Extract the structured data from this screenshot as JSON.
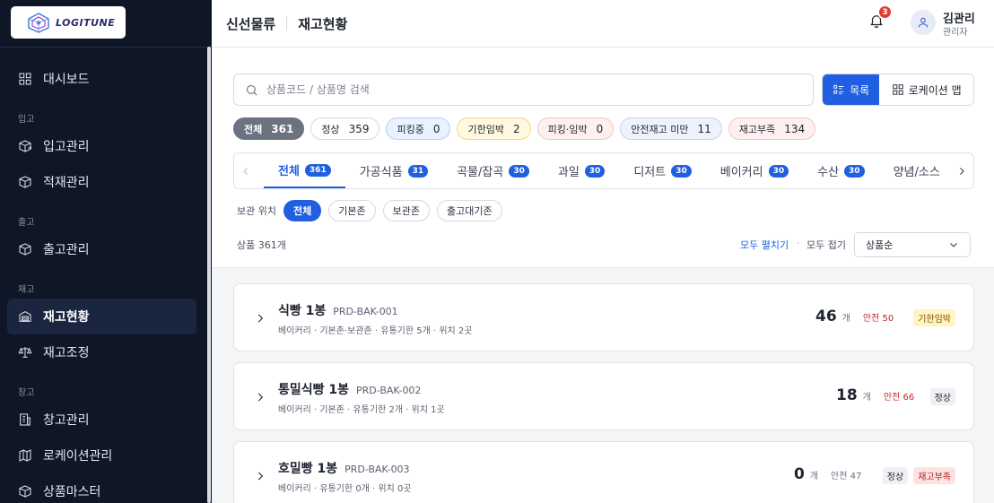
{
  "app": {
    "logo_text": "LOGITUNE",
    "company": "신선물류",
    "page_title": "재고현황"
  },
  "header": {
    "notification_count": "3",
    "user_name": "김관리",
    "user_role": "관리자"
  },
  "sidebar": {
    "top_items": [
      {
        "label": "대시보드",
        "icon": "grid-icon"
      }
    ],
    "sections": [
      {
        "title": "입고",
        "items": [
          {
            "label": "입고관리",
            "icon": "box-in-icon"
          },
          {
            "label": "적재관리",
            "icon": "box-icon"
          }
        ]
      },
      {
        "title": "출고",
        "items": [
          {
            "label": "출고관리",
            "icon": "box-out-icon"
          }
        ]
      },
      {
        "title": "재고",
        "items": [
          {
            "label": "재고현황",
            "icon": "warehouse-icon",
            "active": true
          },
          {
            "label": "재고조정",
            "icon": "scale-icon"
          }
        ]
      },
      {
        "title": "창고",
        "items": [
          {
            "label": "창고관리",
            "icon": "building-icon"
          },
          {
            "label": "로케이션관리",
            "icon": "map-icon"
          },
          {
            "label": "상품마스터",
            "icon": "cube-icon"
          }
        ]
      }
    ]
  },
  "search": {
    "placeholder": "상품코드 / 상품명 검색",
    "value": ""
  },
  "view_toggle": {
    "list_label": "목록",
    "map_label": "로케이션 맵"
  },
  "status_filters": [
    {
      "label": "전체",
      "count": "361",
      "style": "all"
    },
    {
      "label": "정상",
      "count": "359",
      "style": "plain"
    },
    {
      "label": "피킹중",
      "count": "0",
      "style": "blue"
    },
    {
      "label": "기한임박",
      "count": "2",
      "style": "yellow"
    },
    {
      "label": "피킹·임박",
      "count": "0",
      "style": "red"
    },
    {
      "label": "안전재고 미만",
      "count": "11",
      "style": "lblue"
    },
    {
      "label": "재고부족",
      "count": "134",
      "style": "red"
    }
  ],
  "category_tabs": [
    {
      "label": "전체",
      "count": "361",
      "active": true
    },
    {
      "label": "가공식품",
      "count": "31"
    },
    {
      "label": "곡물/잡곡",
      "count": "30"
    },
    {
      "label": "과일",
      "count": "30"
    },
    {
      "label": "디저트",
      "count": "30"
    },
    {
      "label": "베이커리",
      "count": "30"
    },
    {
      "label": "수산",
      "count": "30"
    },
    {
      "label": "양념/소스",
      "count": ""
    }
  ],
  "location_filter": {
    "label": "보관 위치",
    "options": [
      "전체",
      "기본존",
      "보관존",
      "출고대기존"
    ],
    "selected": "전체"
  },
  "list_toolbar": {
    "count_text": "상품 361개",
    "expand_all": "모두 펼치기",
    "separator": "·",
    "collapse_all": "모두 접기",
    "sort_value": "상품순"
  },
  "products": [
    {
      "name": "식빵 1봉",
      "code": "PRD-BAK-001",
      "meta": "베이커리 · 기본존·보관존 · 유통기한 5개 · 위치 2곳",
      "qty": "46",
      "unit": "개",
      "safety": "안전 50",
      "safety_low": true,
      "tags": [
        {
          "label": "기한임박",
          "style": "yellow"
        }
      ]
    },
    {
      "name": "통밀식빵 1봉",
      "code": "PRD-BAK-002",
      "meta": "베이커리 · 기본존 · 유통기한 2개 · 위치 1곳",
      "qty": "18",
      "unit": "개",
      "safety": "안전 66",
      "safety_low": true,
      "tags": [
        {
          "label": "정상",
          "style": "grey"
        }
      ]
    },
    {
      "name": "호밀빵 1봉",
      "code": "PRD-BAK-003",
      "meta": "베이커리 · 유통기한 0개 · 위치 0곳",
      "qty": "0",
      "unit": "개",
      "safety": "안전 47",
      "safety_low": false,
      "tags": [
        {
          "label": "정상",
          "style": "grey"
        },
        {
          "label": "재고부족",
          "style": "red"
        }
      ]
    }
  ]
}
